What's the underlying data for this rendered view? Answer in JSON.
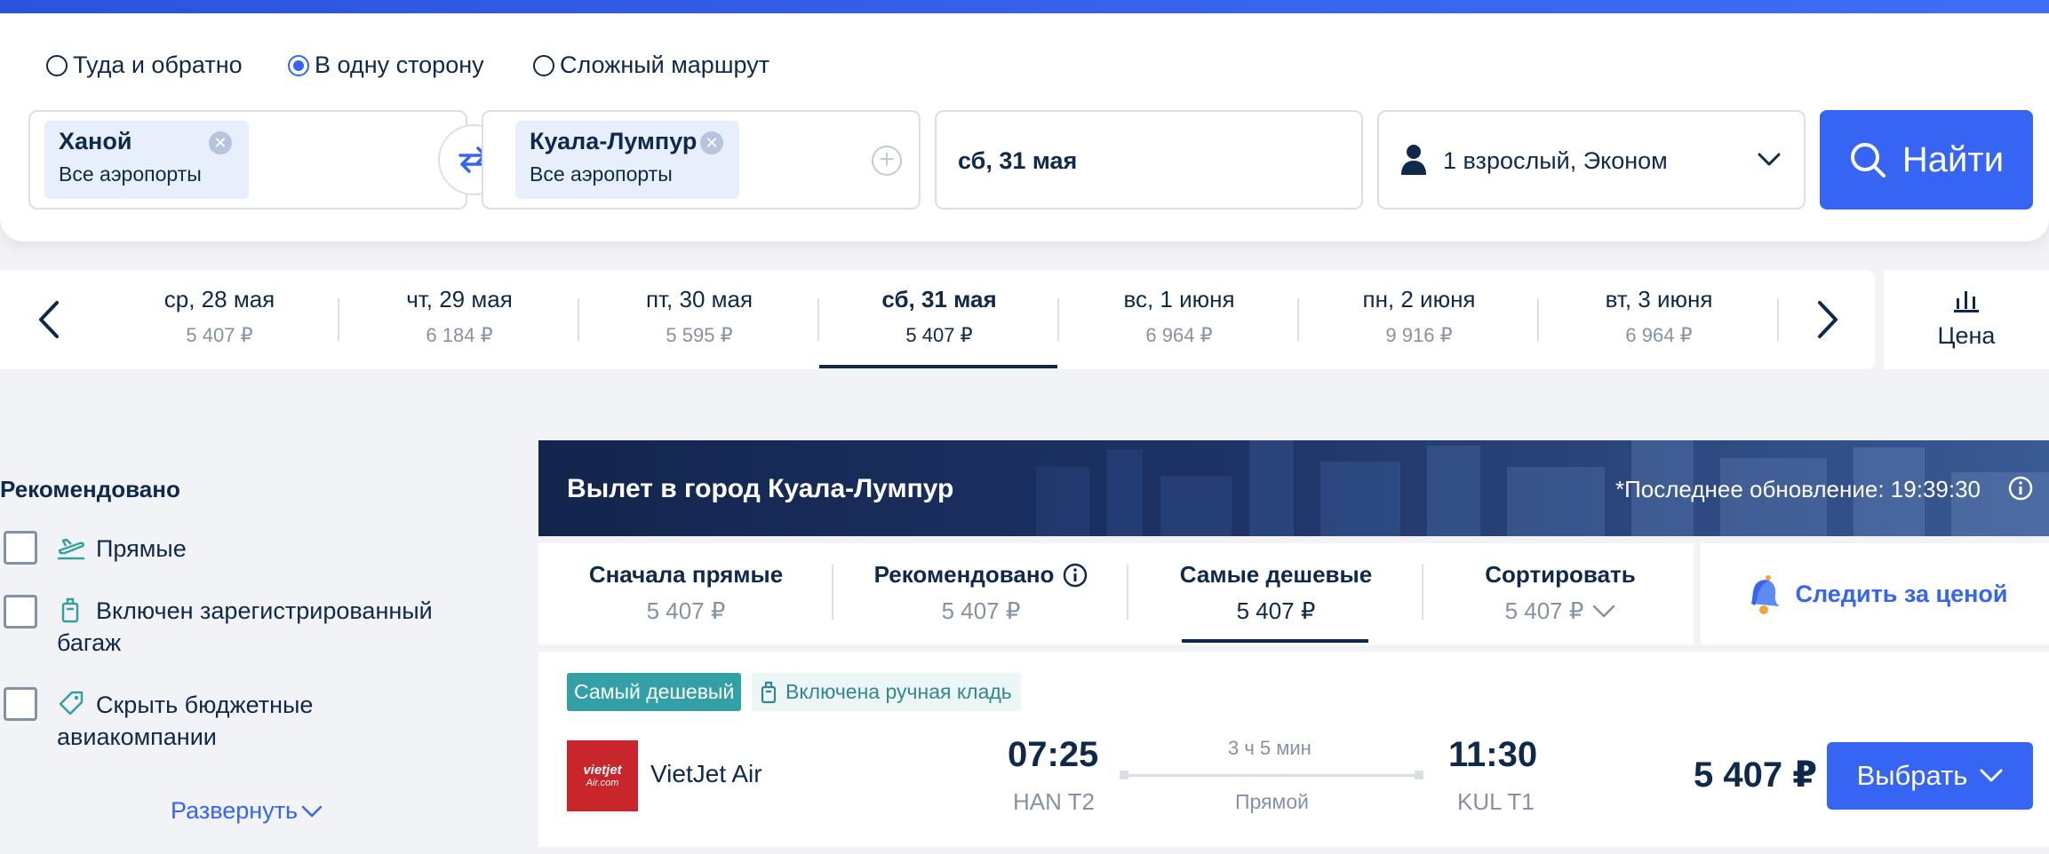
{
  "trip_types": [
    {
      "label": "Туда и обратно",
      "checked": false
    },
    {
      "label": "В одну сторону",
      "checked": true
    },
    {
      "label": "Сложный маршрут",
      "checked": false
    }
  ],
  "origin": {
    "city": "Ханой",
    "sub": "Все аэропорты"
  },
  "destination": {
    "city": "Куала-Лумпур",
    "sub": "Все аэропорты"
  },
  "date_field": "сб, 31 мая",
  "passengers": "1 взрослый, Эконом",
  "search_label": "Найти",
  "dates": [
    {
      "label": "ср, 28 мая",
      "price": "5 407 ₽"
    },
    {
      "label": "чт, 29 мая",
      "price": "6 184 ₽"
    },
    {
      "label": "пт, 30 мая",
      "price": "5 595 ₽"
    },
    {
      "label": "сб, 31 мая",
      "price": "5 407 ₽",
      "active": true
    },
    {
      "label": "вс, 1 июня",
      "price": "6 964 ₽"
    },
    {
      "label": "пн, 2 июня",
      "price": "9 916 ₽"
    },
    {
      "label": "вт, 3 июня",
      "price": "6 964 ₽"
    }
  ],
  "price_tab": "Цена",
  "filters": {
    "title": "Рекомендовано",
    "items": [
      {
        "label": "Прямые"
      },
      {
        "label_line1": "Включен зарегистрированный",
        "label_line2": "багаж"
      },
      {
        "label_line1": "Скрыть бюджетные",
        "label_line2": "авиакомпании"
      }
    ],
    "expand": "Развернуть"
  },
  "banner": {
    "title": "Вылет в город Куала-Лумпур",
    "updated": "*Последнее обновление: 19:39:30"
  },
  "sort": [
    {
      "label": "Сначала прямые",
      "price": "5 407 ₽"
    },
    {
      "label": "Рекомендовано",
      "price": "5 407 ₽"
    },
    {
      "label": "Самые дешевые",
      "price": "5 407 ₽",
      "active": true
    },
    {
      "label": "Сортировать",
      "price": "5 407 ₽"
    }
  ],
  "follow_price": "Следить за ценой",
  "result": {
    "badge_cheap": "Самый дешевый",
    "badge_bag": "Включена ручная кладь",
    "airline": "VietJet Air",
    "logo_line1": "vietjet",
    "logo_line2": "Air.com",
    "dep_time": "07:25",
    "dep_airport": "HAN T2",
    "duration": "3 ч 5 мин",
    "stops": "Прямой",
    "arr_time": "11:30",
    "arr_airport": "KUL T1",
    "price": "5 407 ₽",
    "select": "Выбрать"
  },
  "colors": {
    "accent": "#3565f2",
    "navy": "#0f294d",
    "teal": "#32a0a6"
  }
}
